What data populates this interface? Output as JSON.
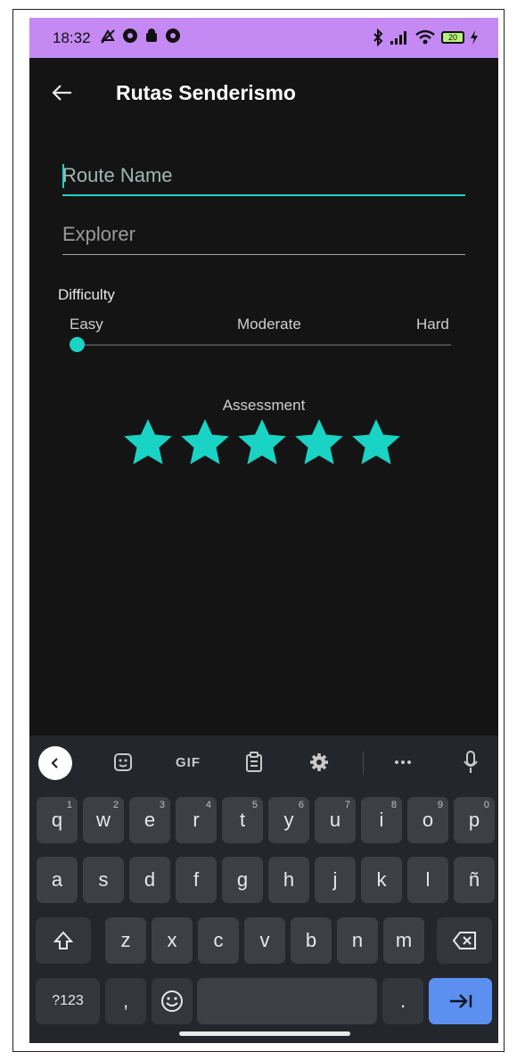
{
  "status_bar": {
    "time": "18:32",
    "battery": "20"
  },
  "app_bar": {
    "title": "Rutas Senderismo"
  },
  "form": {
    "route_name_label": "Route Name",
    "explorer_label": "Explorer",
    "difficulty_label": "Difficulty",
    "difficulty_options": [
      "Easy",
      "Moderate",
      "Hard"
    ],
    "difficulty_value": 0,
    "assessment_label": "Assessment",
    "rating": 5,
    "rating_max": 5
  },
  "colors": {
    "accent": "#19d3c5",
    "status_bar": "#c489f2",
    "background": "#141414",
    "keyboard": "#23262b",
    "enter_key": "#5b8ff0"
  },
  "keyboard": {
    "toolbar": {
      "collapse": "chevron-left-icon",
      "sticker": "sticker-icon",
      "gif": "GIF",
      "clipboard": "clipboard-icon",
      "settings": "gear-icon",
      "more": "more-icon",
      "mic": "microphone-icon"
    },
    "row1": [
      {
        "k": "q",
        "h": "1"
      },
      {
        "k": "w",
        "h": "2"
      },
      {
        "k": "e",
        "h": "3"
      },
      {
        "k": "r",
        "h": "4"
      },
      {
        "k": "t",
        "h": "5"
      },
      {
        "k": "y",
        "h": "6"
      },
      {
        "k": "u",
        "h": "7"
      },
      {
        "k": "i",
        "h": "8"
      },
      {
        "k": "o",
        "h": "9"
      },
      {
        "k": "p",
        "h": "0"
      }
    ],
    "row2": [
      "a",
      "s",
      "d",
      "f",
      "g",
      "h",
      "j",
      "k",
      "l",
      "ñ"
    ],
    "row3": [
      "z",
      "x",
      "c",
      "v",
      "b",
      "n",
      "m"
    ],
    "symbols_key": "?123",
    "comma_key": ",",
    "period_key": "."
  }
}
